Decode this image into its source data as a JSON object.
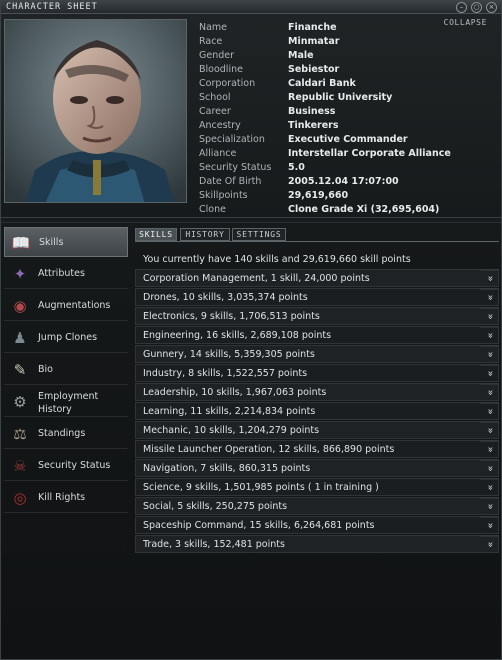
{
  "window": {
    "title": "CHARACTER SHEET",
    "collapse_label": "COLLAPSE"
  },
  "character": {
    "fields": [
      {
        "label": "Name",
        "value": "Finanche"
      },
      {
        "label": "Race",
        "value": "Minmatar"
      },
      {
        "label": "Gender",
        "value": "Male"
      },
      {
        "label": "Bloodline",
        "value": "Sebiestor"
      },
      {
        "label": "Corporation",
        "value": "Caldari Bank"
      },
      {
        "label": "School",
        "value": "Republic University"
      },
      {
        "label": "Career",
        "value": "Business"
      },
      {
        "label": "Ancestry",
        "value": "Tinkerers"
      },
      {
        "label": "Specialization",
        "value": "Executive Commander"
      },
      {
        "label": "Alliance",
        "value": "Interstellar Corporate Alliance"
      },
      {
        "label": "Security Status",
        "value": "5.0"
      },
      {
        "label": "Date Of Birth",
        "value": "2005.12.04 17:07:00"
      },
      {
        "label": "Skillpoints",
        "value": "29,619,660"
      },
      {
        "label": "Clone",
        "value": "Clone Grade Xi (32,695,604)"
      }
    ]
  },
  "sidebar": {
    "items": [
      {
        "label": "Skills",
        "icon": "book-icon",
        "active": true
      },
      {
        "label": "Attributes",
        "icon": "attributes-icon"
      },
      {
        "label": "Augmentations",
        "icon": "augmentations-icon"
      },
      {
        "label": "Jump Clones",
        "icon": "jump-clones-icon"
      },
      {
        "label": "Bio",
        "icon": "bio-icon"
      },
      {
        "label": "Employment",
        "label2": "History",
        "icon": "employment-history-icon"
      },
      {
        "label": "Standings",
        "icon": "standings-icon"
      },
      {
        "label": "Security Status",
        "icon": "security-status-icon"
      },
      {
        "label": "Kill Rights",
        "icon": "kill-rights-icon"
      }
    ]
  },
  "tabs": [
    {
      "label": "SKILLS",
      "active": true
    },
    {
      "label": "HISTORY"
    },
    {
      "label": "SETTINGS"
    }
  ],
  "skills": {
    "summary": "You currently have 140 skills and 29,619,660 skill points",
    "groups": [
      "Corporation Management, 1 skill, 24,000 points",
      "Drones, 10 skills, 3,035,374 points",
      "Electronics, 9 skills, 1,706,513 points",
      "Engineering, 16 skills, 2,689,108 points",
      "Gunnery, 14 skills, 5,359,305 points",
      "Industry, 8 skills, 1,522,557 points",
      "Leadership, 10 skills, 1,967,063 points",
      "Learning, 11 skills, 2,214,834 points",
      "Mechanic, 10 skills, 1,204,279 points",
      "Missile Launcher Operation, 12 skills, 866,890 points",
      "Navigation, 7 skills, 860,315 points",
      "Science, 9 skills, 1,501,985 points ( 1 in training )",
      "Social, 5 skills, 250,275 points",
      "Spaceship Command, 15 skills, 6,264,681 points",
      "Trade, 3 skills, 152,481 points"
    ],
    "expand_glyph": "»"
  }
}
